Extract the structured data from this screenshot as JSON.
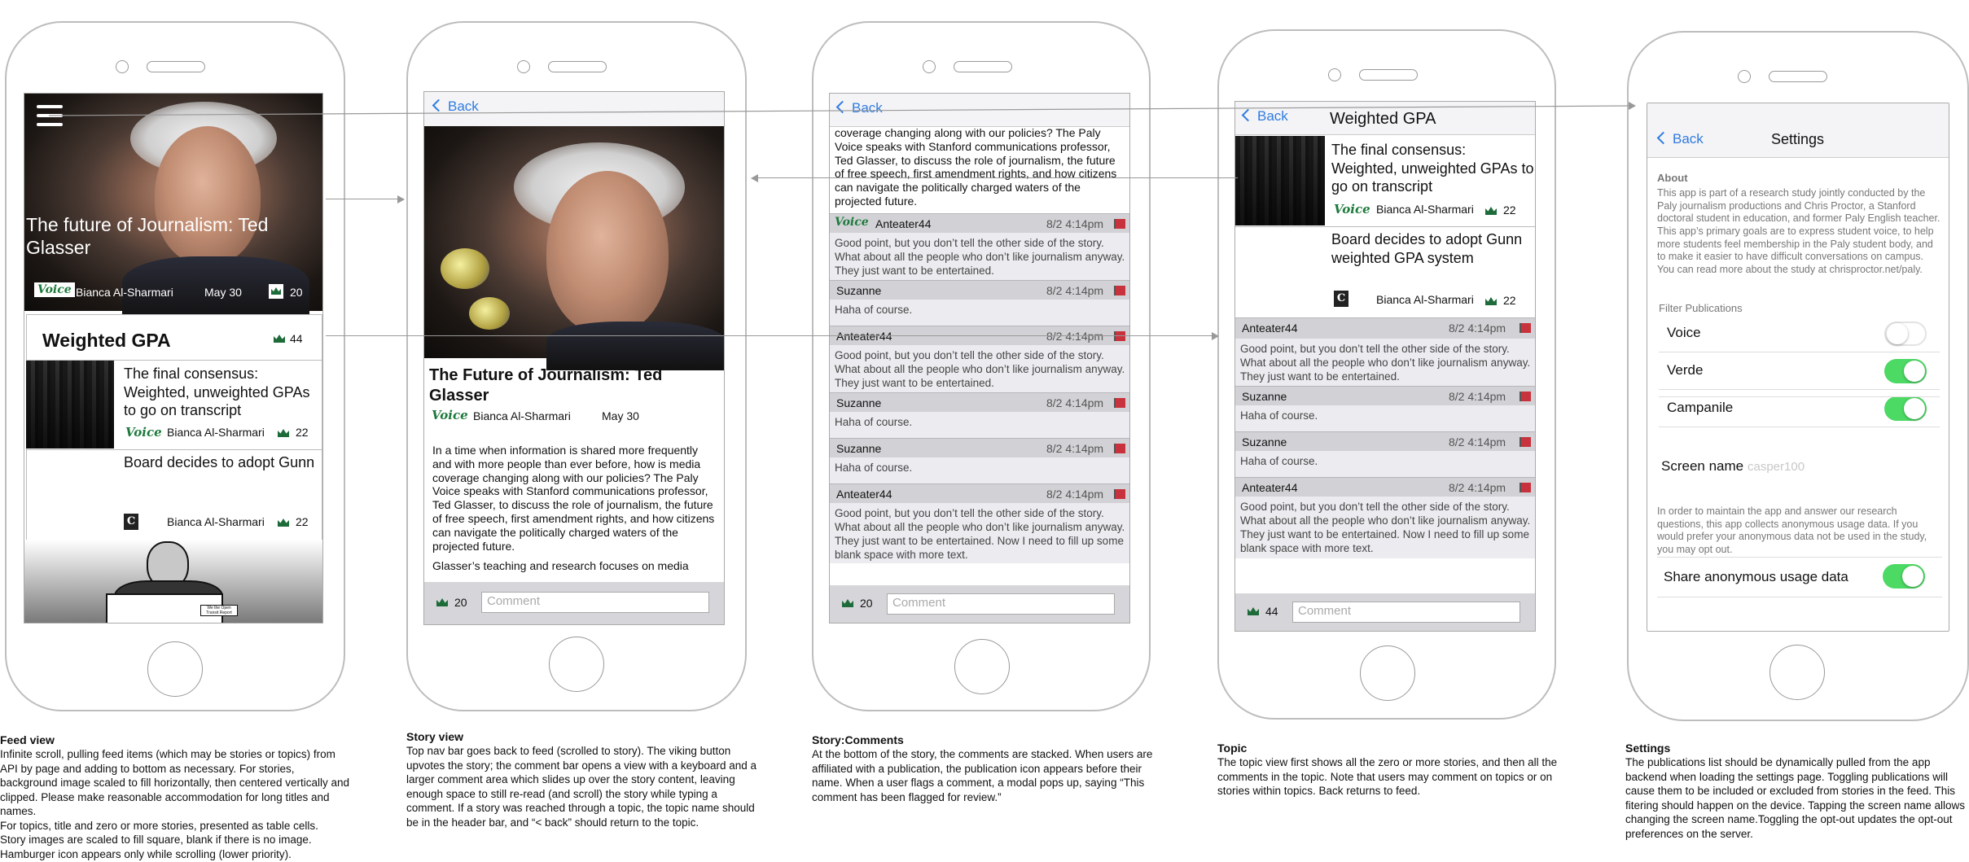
{
  "meta_page": "Feed view / Story view / Story:Comments / Topic / Settings wireframes",
  "feed": {
    "hero_title": "The future of Journalism: Ted Glasser",
    "hero_author": "Bianca Al-Sharmari",
    "hero_date": "May 30",
    "hero_votes": "20",
    "topic_title": "Weighted GPA",
    "topic_votes": "44",
    "item1_title": "The final consensus: Weighted, unweighted GPAs to go on transcript",
    "item1_pub": "Voice",
    "item1_author": "Bianca Al-Sharmari",
    "item1_votes": "22",
    "item2_title": "Board decides to adopt Gunn",
    "item2_pub": "C",
    "item2_author": "Bianca Al-Sharmari",
    "item2_votes": "22",
    "cartoon_sign": "We the Open Transit Report"
  },
  "story": {
    "back": "Back",
    "title": "The Future of Journalism: Ted Glasser",
    "pub": "Voice",
    "author": "Bianca Al-Sharmari",
    "date": "May 30",
    "body": "In a time when information is shared more frequently and with more people than ever before, how is media coverage changing along with our policies? The Paly Voice speaks with Stanford communications professor, Ted Glasser, to discuss the role of journalism, the future of free speech, first amendment rights, and how citizens can navigate the politically charged waters of the projected future.",
    "body2": "Glasser’s teaching and research focuses on media",
    "votes": "20",
    "comment_placeholder": "Comment"
  },
  "comments": {
    "back": "Back",
    "story_tail": "coverage changing along with our policies? The Paly Voice speaks with Stanford communications professor, Ted Glasser, to discuss the role of journalism, the future of free speech, first amendment rights, and how citizens can navigate the politically charged waters of the projected future.",
    "items": [
      {
        "pub": "Voice",
        "name": "Anteater44",
        "time": "8/2 4:14pm",
        "text": "Good point, but you don’t tell the other side of the story. What about all the people who don’t like journalism anyway. They just want to be entertained."
      },
      {
        "pub": "",
        "name": "Suzanne",
        "time": "8/2 4:14pm",
        "text": "Haha of course."
      },
      {
        "pub": "",
        "name": "Anteater44",
        "time": "8/2 4:14pm",
        "text": "Good point, but you don’t tell the other side of the story. What about all the people who don’t like journalism anyway. They just want to be entertained."
      },
      {
        "pub": "",
        "name": "Suzanne",
        "time": "8/2 4:14pm",
        "text": "Haha of course."
      },
      {
        "pub": "",
        "name": "Suzanne",
        "time": "8/2 4:14pm",
        "text": "Haha of course."
      },
      {
        "pub": "",
        "name": "Anteater44",
        "time": "8/2 4:14pm",
        "text": "Good point, but you don’t tell the other side of the story. What about all the people who don’t like journalism anyway. They just want to be entertained. Now I need to fill up some blank space with more text."
      }
    ],
    "votes": "20",
    "comment_placeholder": "Comment"
  },
  "topic": {
    "back": "Back",
    "title": "Weighted GPA",
    "story1_title": "The final consensus: Weighted, unweighted GPAs to go on transcript",
    "story1_pub": "Voice",
    "story1_author": "Bianca Al-Sharmari",
    "story1_votes": "22",
    "story2_title": "Board decides to adopt Gunn weighted GPA system",
    "story2_pub": "C",
    "story2_author": "Bianca Al-Sharmari",
    "story2_votes": "22",
    "items": [
      {
        "name": "Anteater44",
        "time": "8/2 4:14pm",
        "text": "Good point, but you don’t tell the other side of the story. What about all the people who don’t like journalism anyway. They just want to be entertained."
      },
      {
        "name": "Suzanne",
        "time": "8/2 4:14pm",
        "text": "Haha of course."
      },
      {
        "name": "Suzanne",
        "time": "8/2 4:14pm",
        "text": "Haha of course."
      },
      {
        "name": "Anteater44",
        "time": "8/2 4:14pm",
        "text": "Good point, but you don’t tell the other side of the story. What about all the people who don’t like journalism anyway. They just want to be entertained. Now I need to fill up some blank space with more text."
      }
    ],
    "votes": "44",
    "comment_placeholder": "Comment"
  },
  "settings": {
    "back": "Back",
    "title": "Settings",
    "about_label": "About",
    "about_text": "This app is part of a research study jointly conducted by the Paly journalism productions and Chris Proctor, a Stanford doctoral student in education, and former Paly English teacher. This app’s primary goals are to express student voice, to help more students feel membership in the Paly student body, and to make it easier to have difficult conversations on campus. You can read more about the study at chrisproctor.net/paly.",
    "filter_label": "Filter Publications",
    "publications": [
      {
        "name": "Voice",
        "on": false
      },
      {
        "name": "Verde",
        "on": true
      },
      {
        "name": "Campanile",
        "on": true
      }
    ],
    "screen_name_label": "Screen name",
    "screen_name_value": "casper100",
    "usage_text": "In order to maintain the app and answer our research questions, this app collects anonymous usage data. If you would prefer your anonymous data not be used in the study, you may opt out.",
    "share_label": "Share anonymous usage data",
    "share_on": true
  },
  "captions": {
    "feed_title": "Feed view",
    "feed_text": "Infinite scroll, pulling feed items (which may be stories or topics) from API by page and adding to bottom as necessary.  For stories, background image scaled to fill horizontally, then centered vertically and clipped. Please make reasonable accommodation for long titles and names.\nFor topics, title and zero or more stories, presented as table cells.\nStory images are scaled to fill square, blank if there is no image.\nHamburger icon appears only while scrolling (lower priority).",
    "story_title": "Story view",
    "story_text": "Top nav bar goes back to feed (scrolled to story).  The viking button upvotes the story; the comment bar opens a view with a keyboard and a larger comment area which slides up over the story content, leaving enough space to still re-read (and scroll) the story while typing a comment. If a story was reached through a topic, the topic name should be in the header bar, and “< back” should return to the topic.",
    "comments_title": "Story:Comments",
    "comments_text": "At the bottom of the story, the comments are stacked. When users are affiliated with a publication, the publication icon appears before their name. When a user flags a comment, a modal pops up, saying “This comment has been flagged for review.”",
    "topic_title": "Topic",
    "topic_text": "The topic view first shows all the zero or more stories, and then all the comments in the topic. Note that users may comment on topics or on stories within topics. Back returns to feed.",
    "settings_title": "Settings",
    "settings_text": "The publications list should be dynamically pulled from the app backend when loading the settings page. Toggling publications will cause them to be included or excluded from stories in the feed. This fitering should happen on the device. Tapping the screen name allows changing the screen name.Toggling the opt-out updates the opt-out preferences on the server."
  },
  "colors": {
    "accent": "#2f7be0",
    "toggle_on": "#4cd964",
    "flag": "#c8323c",
    "voice_green": "#1e7a3c"
  }
}
